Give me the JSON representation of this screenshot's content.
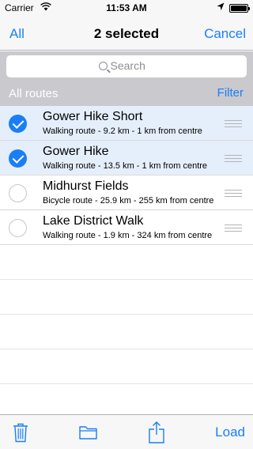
{
  "status_bar": {
    "carrier": "Carrier",
    "time": "11:53 AM"
  },
  "nav": {
    "left_button": "All",
    "title": "2 selected",
    "right_button": "Cancel"
  },
  "search": {
    "placeholder": "Search"
  },
  "section": {
    "label": "All routes",
    "filter_button": "Filter"
  },
  "routes": [
    {
      "title": "Gower Hike Short",
      "subtitle": "Walking route - 9.2 km - 1 km from centre",
      "selected": true
    },
    {
      "title": "Gower Hike",
      "subtitle": "Walking route - 13.5 km - 1 km from centre",
      "selected": true
    },
    {
      "title": "Midhurst Fields",
      "subtitle": "Bicycle route - 25.9 km - 255 km from centre",
      "selected": false
    },
    {
      "title": "Lake District Walk",
      "subtitle": "Walking route - 1.9 km - 324 km from centre",
      "selected": false
    }
  ],
  "toolbar": {
    "load_button": "Load",
    "icons": [
      "trash-icon",
      "folder-icon",
      "share-icon"
    ]
  },
  "colors": {
    "accent": "#1a7ff6",
    "selected_row": "#e5effb",
    "header_bg": "#c9c9ce"
  }
}
